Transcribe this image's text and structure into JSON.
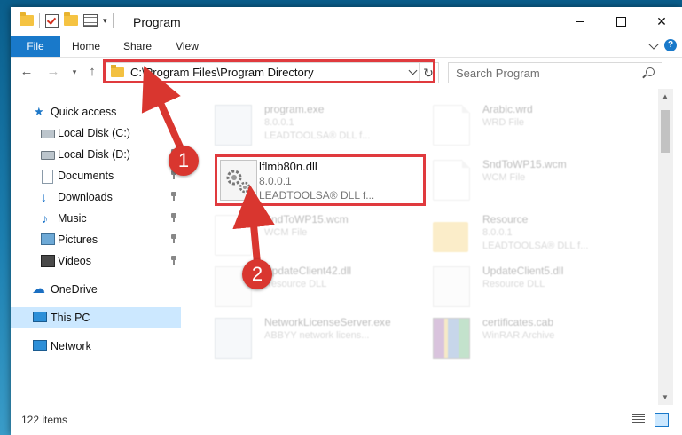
{
  "window": {
    "title": "Program"
  },
  "ribbon": {
    "tabs": [
      "File",
      "Home",
      "Share",
      "View"
    ]
  },
  "address": {
    "path": "C:\\Program Files\\Program Directory"
  },
  "search": {
    "placeholder": "Search Program"
  },
  "sidebar": {
    "items": [
      {
        "label": "Quick access",
        "icon": "star-icon"
      },
      {
        "label": "Local Disk (C:)",
        "icon": "drive-icon"
      },
      {
        "label": "Local Disk (D:)",
        "icon": "drive-icon"
      },
      {
        "label": "Documents",
        "icon": "documents-icon"
      },
      {
        "label": "Downloads",
        "icon": "download-icon"
      },
      {
        "label": "Music",
        "icon": "music-icon"
      },
      {
        "label": "Pictures",
        "icon": "pictures-icon"
      },
      {
        "label": "Videos",
        "icon": "video-icon"
      },
      {
        "label": "OneDrive",
        "icon": "cloud-icon"
      },
      {
        "label": "This PC",
        "icon": "computer-icon"
      },
      {
        "label": "Network",
        "icon": "network-icon"
      }
    ]
  },
  "files": [
    {
      "name": "program.exe",
      "line2": "8.0.0.1",
      "line3": "LEADTOOLSA® DLL f...",
      "icon": "exe-icon"
    },
    {
      "name": "Arabic.wrd",
      "line2": "WRD File",
      "line3": "",
      "icon": "document-icon"
    },
    {
      "name": "lflmb80n.dll",
      "line2": "8.0.0.1",
      "line3": "LEADTOOLSA® DLL f...",
      "icon": "dll-gear-icon"
    },
    {
      "name": "SndToWP15.wcm",
      "line2": "WCM File",
      "line3": "",
      "icon": "document-icon"
    },
    {
      "name": "SndToWP15.wcm",
      "line2": "WCM File",
      "line3": "",
      "icon": "document-icon"
    },
    {
      "name": "Resource",
      "line2": "8.0.0.1",
      "line3": "LEADTOOLSA® DLL f...",
      "icon": "folder-icon"
    },
    {
      "name": "UpdateClient42.dll",
      "line2": "Resource DLL",
      "line3": "",
      "icon": "dll-gear-icon"
    },
    {
      "name": "UpdateClient5.dll",
      "line2": "Resource DLL",
      "line3": "",
      "icon": "dll-gear-icon"
    },
    {
      "name": "NetworkLicenseServer.exe",
      "line2": "ABBYY network licens...",
      "line3": "",
      "icon": "exe-icon"
    },
    {
      "name": "certificates.cab",
      "line2": "WinRAR Archive",
      "line3": "",
      "icon": "archive-icon"
    }
  ],
  "status": {
    "items_count": "122 items"
  },
  "annotations": {
    "step1": "1",
    "step2": "2"
  },
  "colors": {
    "accent": "#1979ca",
    "highlight": "#e03a3e",
    "selection": "#cce8ff"
  }
}
